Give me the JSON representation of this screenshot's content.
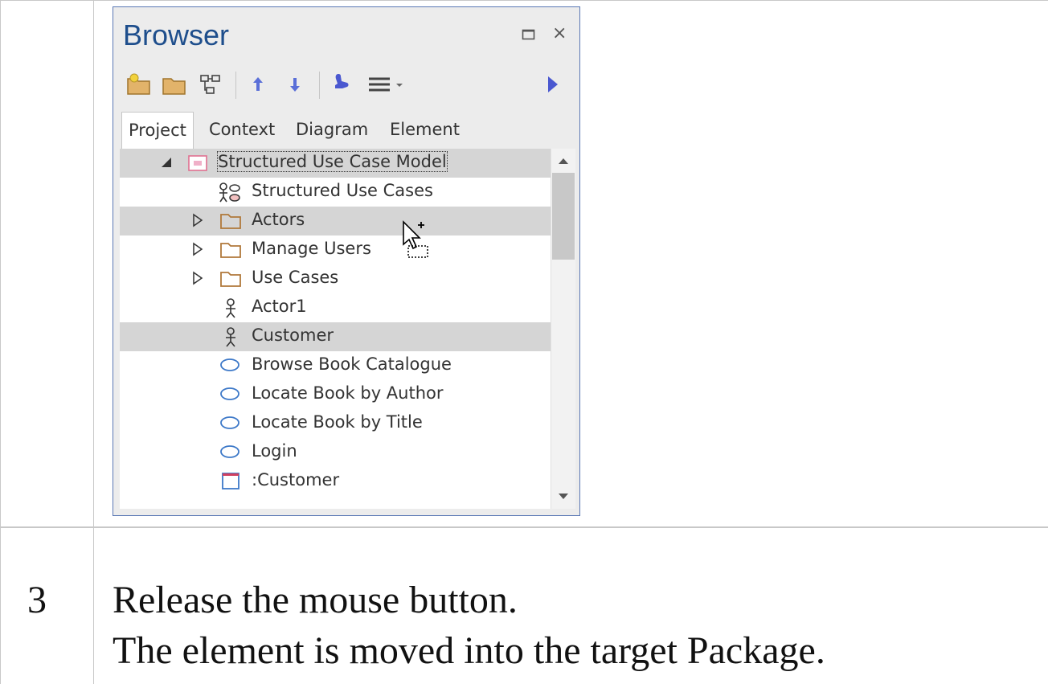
{
  "browser": {
    "title": "Browser",
    "maximize_glyph": "☐",
    "close_glyph": "×",
    "toolbar": [
      "new-package-icon",
      "folder-icon",
      "diagram-icon",
      "arrow-up-icon",
      "arrow-down-icon",
      "pin-icon",
      "menu-icon",
      "expand-right-icon"
    ],
    "tabs": [
      "Project",
      "Context",
      "Diagram",
      "Element"
    ],
    "active_tab": "Project",
    "tree": [
      {
        "label": "Structured Use Case Model",
        "icon": "model-icon",
        "expanded": true,
        "highlighted": true
      },
      {
        "label": "Structured Use Cases",
        "icon": "use-case-diagram-icon"
      },
      {
        "label": "Actors",
        "icon": "folder-icon",
        "collapsed": true,
        "highlighted": true
      },
      {
        "label": "Manage Users",
        "icon": "folder-icon",
        "collapsed": true
      },
      {
        "label": "Use Cases",
        "icon": "folder-icon",
        "collapsed": true
      },
      {
        "label": "Actor1",
        "icon": "actor-icon"
      },
      {
        "label": "Customer",
        "icon": "actor-icon",
        "highlighted": true
      },
      {
        "label": "Browse Book Catalogue",
        "icon": "use-case-icon"
      },
      {
        "label": "Locate Book by Author",
        "icon": "use-case-icon"
      },
      {
        "label": "Locate Book by Title",
        "icon": "use-case-icon"
      },
      {
        "label": "Login",
        "icon": "use-case-icon"
      },
      {
        "label": ":Customer",
        "icon": "instance-icon"
      }
    ]
  },
  "steps": [
    {
      "number": "3",
      "lines": [
        "Release the mouse button.",
        "The element is moved into the target Package."
      ]
    }
  ],
  "colors": {
    "title": "#1e4e8c",
    "folder": "#d9a35a",
    "usecase": "#3c78c8",
    "highlight": "#d5d5d5"
  }
}
